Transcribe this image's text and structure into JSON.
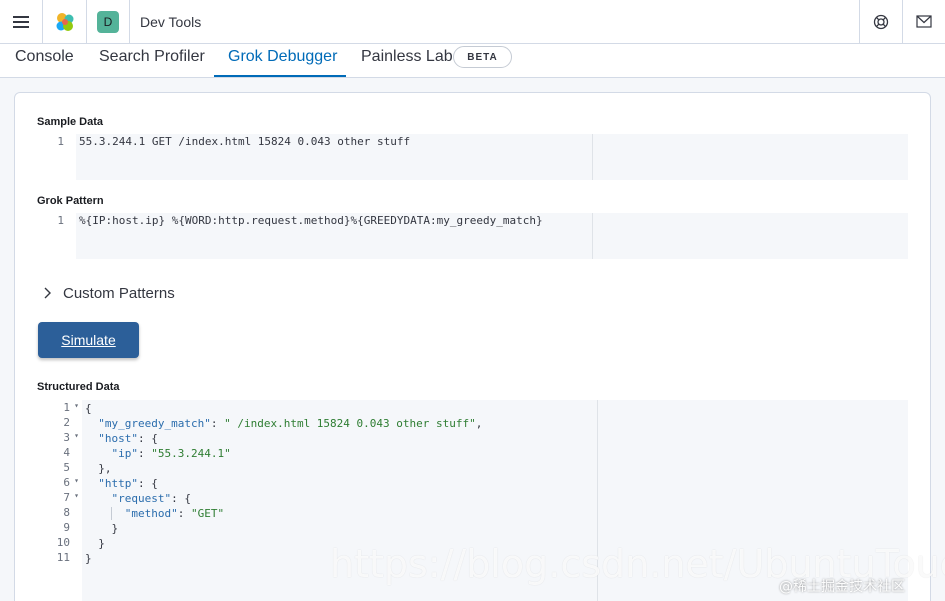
{
  "header": {
    "title": "Dev Tools",
    "space_initial": "D",
    "space_color": "#54b399",
    "icons": [
      "menu-icon",
      "elastic-logo-icon",
      "help-icon",
      "mail-icon"
    ]
  },
  "tabs": [
    {
      "label": "Console",
      "active": false
    },
    {
      "label": "Search Profiler",
      "active": false
    },
    {
      "label": "Grok Debugger",
      "active": true
    },
    {
      "label": "Painless Lab",
      "active": false
    }
  ],
  "beta_badge": "BETA",
  "sample_data": {
    "label": "Sample Data",
    "line_number": "1",
    "value": "55.3.244.1 GET /index.html 15824 0.043 other stuff"
  },
  "grok_pattern": {
    "label": "Grok Pattern",
    "line_number": "1",
    "value": "%{IP:host.ip} %{WORD:http.request.method}%{GREEDYDATA:my_greedy_match}"
  },
  "custom_patterns": {
    "label": "Custom Patterns"
  },
  "simulate_button": "Simulate",
  "structured_data": {
    "label": "Structured Data",
    "line_numbers": [
      "1",
      "2",
      "3",
      "4",
      "5",
      "6",
      "7",
      "8",
      "9",
      "10",
      "11"
    ],
    "fold_markers": [
      "1",
      "3",
      "6",
      "7"
    ],
    "lines": [
      "{",
      "  \"my_greedy_match\": \" /index.html 15824 0.043 other stuff\",",
      "  \"host\": {",
      "    \"ip\": \"55.3.244.1\"",
      "  },",
      "  \"http\": {",
      "    \"request\": {",
      "      \"method\": \"GET\"",
      "    }",
      "  }",
      "}"
    ]
  },
  "watermark": {
    "main": "https://blog.csdn.net/UbuntuTouch",
    "secondary": "@稀土掘金技术社区"
  },
  "colors": {
    "accent": "#006bb8",
    "button": "#2c5f99",
    "json_key": "#2b6dad",
    "json_string": "#2e7d32"
  }
}
